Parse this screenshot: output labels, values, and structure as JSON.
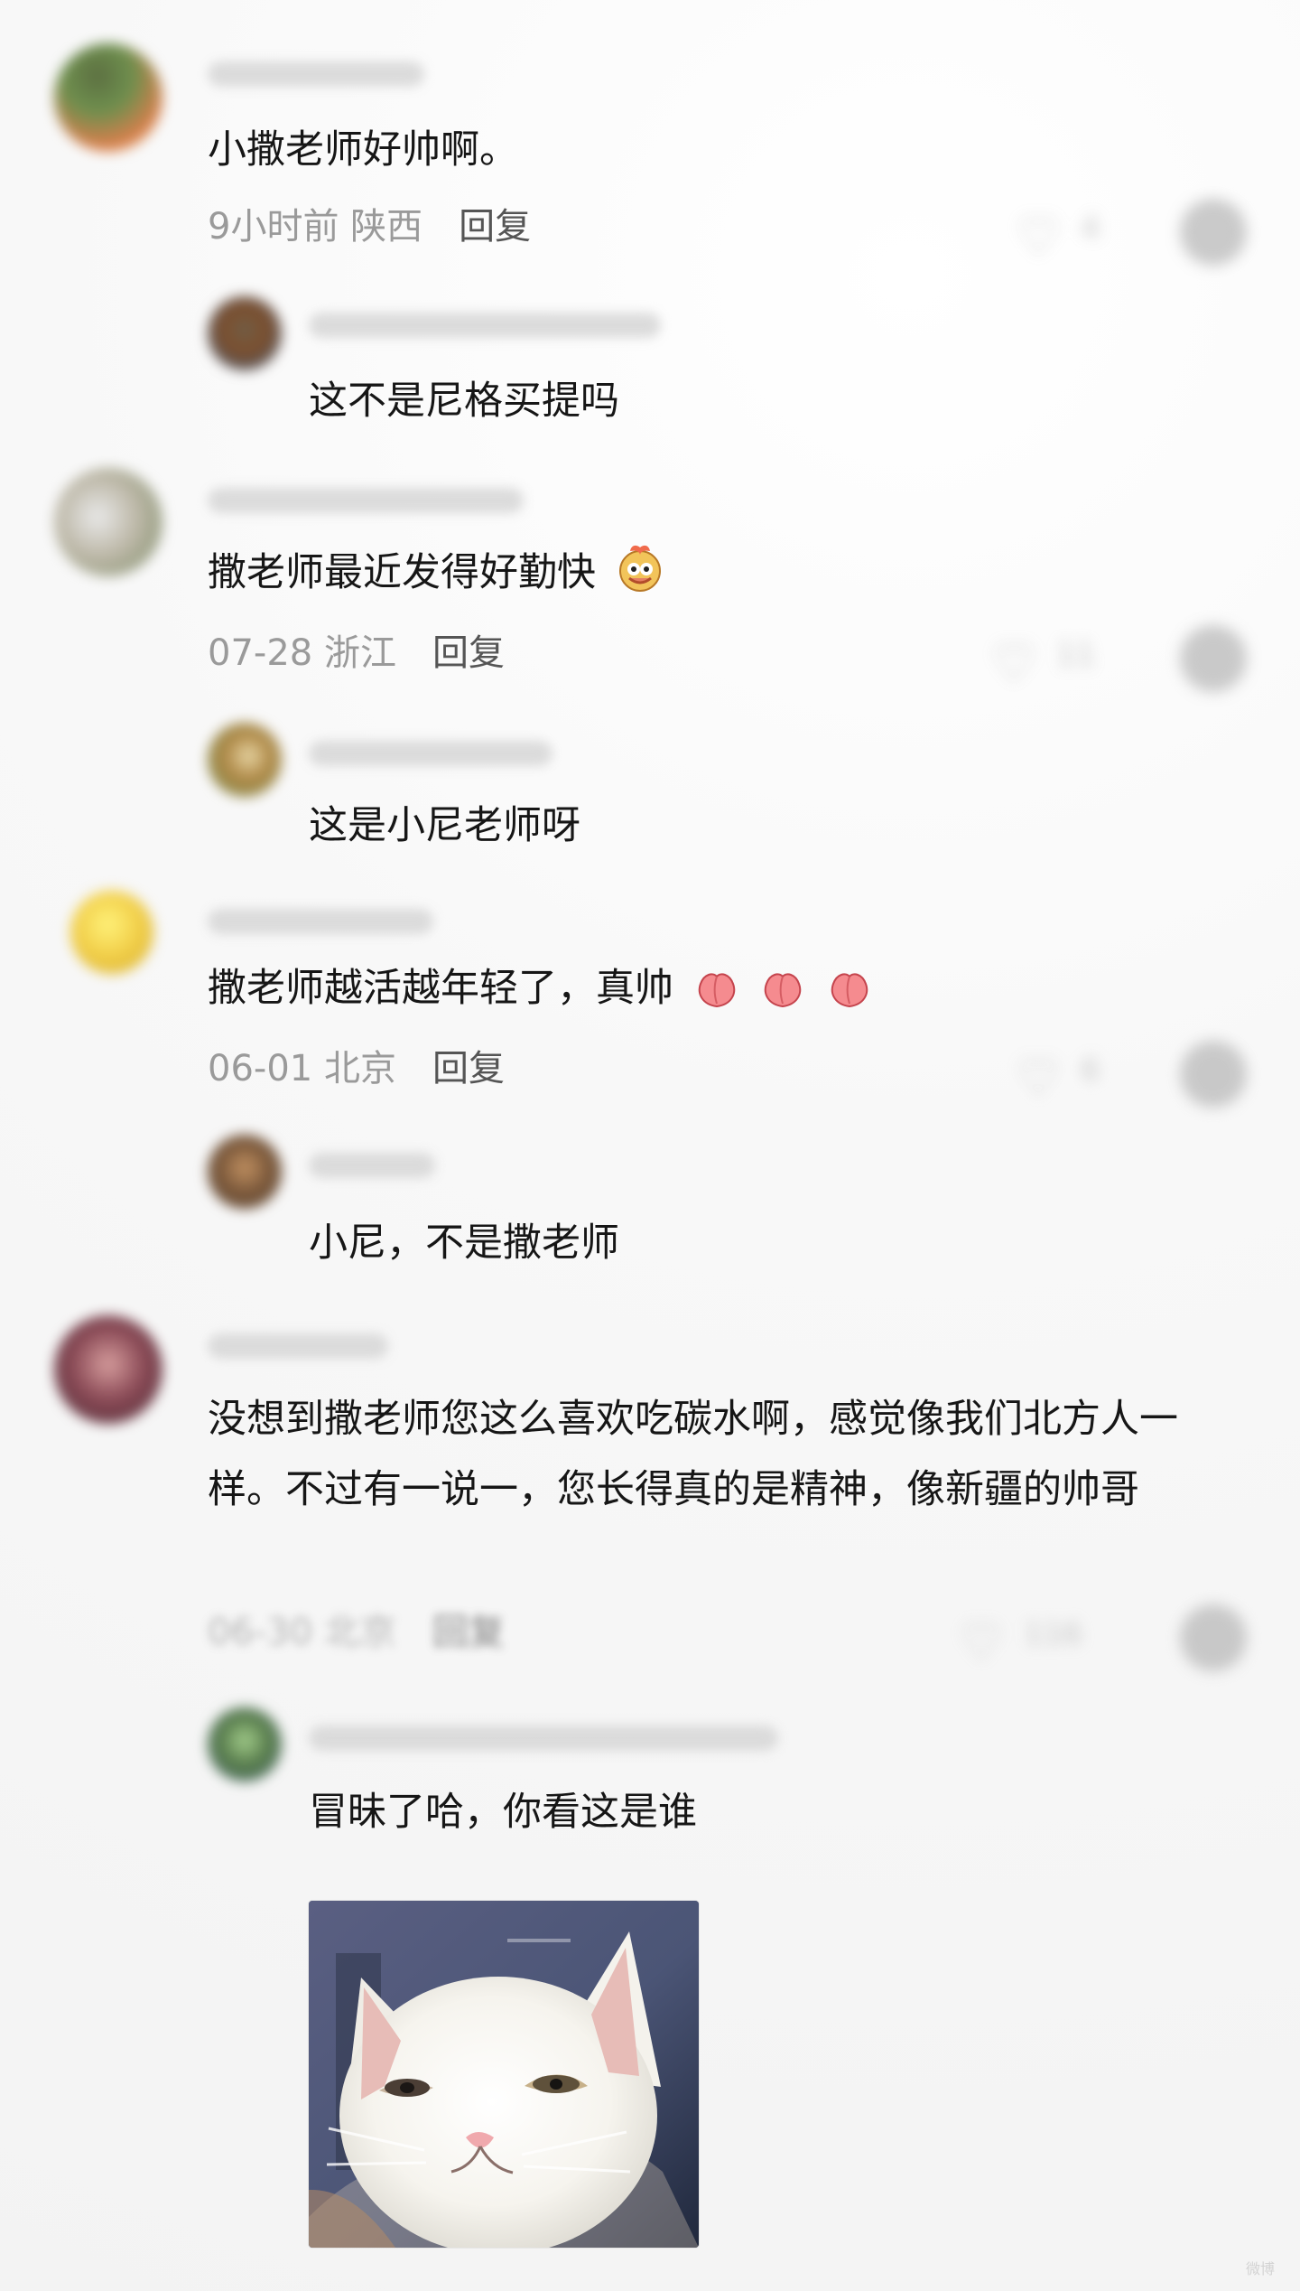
{
  "comments": [
    {
      "text": "小撒老师好帅啊。",
      "time_location": "9小时前 陕西",
      "reply_label": "回复",
      "like_count": "4",
      "reply": {
        "text": "这不是尼格买提吗"
      }
    },
    {
      "text": "撒老师最近发得好勤快",
      "time_location": "07-28 浙江",
      "reply_label": "回复",
      "like_count": "11",
      "reply": {
        "text": "这是小尼老师呀"
      }
    },
    {
      "text": "撒老师越活越年轻了，真帅",
      "time_location": "06-01 北京",
      "reply_label": "回复",
      "like_count": "6",
      "reply": {
        "text": "小尼，不是撒老师"
      }
    },
    {
      "text": "没想到撒老师您这么喜欢吃碳水啊，感觉像我们北方人一样。不过有一说一，您长得真的是精神，像新疆的帅哥",
      "time_location": "06-30 北京",
      "reply_label": "回复",
      "like_count": "116",
      "reply": {
        "text": "冒昧了哈，你看这是谁"
      }
    }
  ],
  "watermark": "微博"
}
